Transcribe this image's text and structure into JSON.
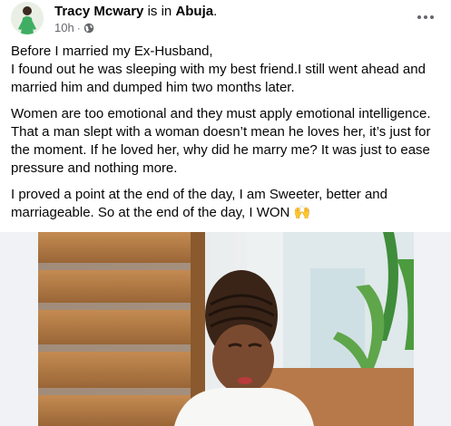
{
  "post": {
    "author": "Tracy Mcwary",
    "is_in": "is in",
    "location": "Abuja",
    "period": ".",
    "time": "10h",
    "dot": "·",
    "privacy_icon": "globe-icon",
    "more_icon": "more-options-icon"
  },
  "content": {
    "p1_l1": "Before I married my Ex-Husband,",
    "p1_l2": "I found out he was sleeping with my best friend.I still went ahead and",
    "p1_l3": "married him and dumped him two months later.",
    "p2_l1": "Women are too emotional and they must apply emotional intelligence.",
    "p2_l2": "That a man slept with a woman doesn’t mean he loves her, it’s just for",
    "p2_l3": "the moment. If he loved her, why did he marry me? It was just to ease",
    "p2_l4": "pressure and nothing more.",
    "p3_l1": "I proved a point at the end of the day, I am Sweeter, better and",
    "p3_l2": "marriageable. So at the end of the day, I WON 🙌"
  },
  "colors": {
    "text": "#050505",
    "secondary": "#65676b",
    "wood": "#b07a45",
    "skin": "#7a4a30"
  }
}
